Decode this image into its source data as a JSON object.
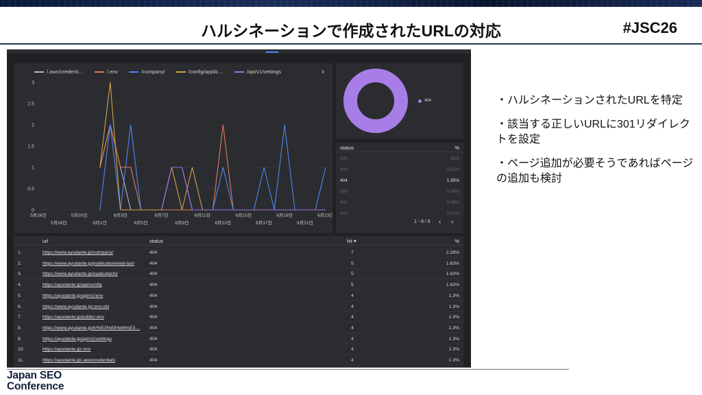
{
  "slide": {
    "title": "ハルシネーションで作成されたURLの対応",
    "hashtag": "#JSC26",
    "bullets": [
      "・ハルシネーションされたURLを特定",
      "・該当する正しいURLに301リダイレクトを設定",
      "・ページ追加が必要そうであればページの追加も検討"
    ],
    "logo_line1": "Japan SEO",
    "logo_line2": "Conference"
  },
  "line_chart": {
    "legend": [
      {
        "label": "/.aws/credenti…",
        "color": "#b8b8b8"
      },
      {
        "label": "/.env",
        "color": "#e07a5f"
      },
      {
        "label": "/company/",
        "color": "#4f86f7"
      },
      {
        "label": "/config/applic…",
        "color": "#d4a24c"
      },
      {
        "label": "/api/v1/settings",
        "color": "#a070e0"
      }
    ],
    "arrow": "›"
  },
  "chart_data": {
    "type": "line",
    "x_upper": [
      "5月26日",
      "5月30日",
      "6月3日",
      "6月7日",
      "6月11日",
      "6月15日",
      "6月19日",
      "6月23日"
    ],
    "x_lower": [
      "5月28日",
      "6月1日",
      "6月5日",
      "6月9日",
      "6月13日",
      "6月17日",
      "6月21日"
    ],
    "y_ticks": [
      "0",
      "0.5",
      "1",
      "1.5",
      "2",
      "2.5",
      "3"
    ],
    "ylim": [
      0,
      3
    ],
    "x_range": [
      0,
      28
    ],
    "series": [
      {
        "name": "/.aws/credenti…",
        "color": "#b8b8b8",
        "points": [
          [
            6,
            1
          ],
          [
            7,
            2
          ],
          [
            8,
            1
          ],
          [
            9,
            0
          ]
        ]
      },
      {
        "name": "/.env",
        "color": "#e07a5f",
        "points": [
          [
            6,
            1
          ],
          [
            7,
            2
          ],
          [
            8,
            1
          ],
          [
            9,
            1
          ],
          [
            10,
            0
          ],
          [
            17,
            0
          ],
          [
            18,
            2
          ],
          [
            19,
            0
          ],
          [
            28,
            0
          ]
        ]
      },
      {
        "name": "/company/",
        "color": "#4f86f7",
        "points": [
          [
            6,
            0
          ],
          [
            7,
            2
          ],
          [
            8,
            0
          ],
          [
            9,
            2
          ],
          [
            10,
            0
          ],
          [
            12,
            0
          ],
          [
            13,
            1
          ],
          [
            14,
            1
          ],
          [
            15,
            0
          ],
          [
            17,
            0
          ],
          [
            18,
            1
          ],
          [
            19,
            0
          ],
          [
            21,
            0
          ],
          [
            22,
            1
          ],
          [
            23,
            0
          ],
          [
            24,
            2
          ],
          [
            25,
            0
          ],
          [
            27,
            0
          ],
          [
            28,
            1
          ]
        ]
      },
      {
        "name": "/config/applic…",
        "color": "#d4a24c",
        "points": [
          [
            6,
            1
          ],
          [
            7,
            3
          ],
          [
            8,
            0
          ],
          [
            12,
            0
          ],
          [
            13,
            1
          ],
          [
            14,
            0
          ],
          [
            15,
            1
          ],
          [
            16,
            0
          ],
          [
            28,
            0
          ]
        ]
      },
      {
        "name": "/api/v1/settings",
        "color": "#a070e0",
        "points": [
          [
            12,
            0
          ],
          [
            13,
            1
          ],
          [
            14,
            1
          ],
          [
            15,
            0
          ],
          [
            28,
            0
          ]
        ]
      }
    ]
  },
  "donut": {
    "legend_label": "404",
    "color": "#a87de8",
    "percent": 100
  },
  "status_table": {
    "headers": {
      "status": "status",
      "pct": "%"
    },
    "rows": [
      {
        "status": "200",
        "pct": "95%",
        "hl": false
      },
      {
        "status": "301",
        "pct": "3.52%",
        "hl": false
      },
      {
        "status": "404",
        "pct": "1.35%",
        "hl": true
      },
      {
        "status": "500",
        "pct": "0.06%",
        "hl": false
      },
      {
        "status": "401",
        "pct": "0.05%",
        "hl": false
      },
      {
        "status": "403",
        "pct": "0.02%",
        "hl": false
      }
    ],
    "pager": "1 - 6 / 6",
    "prev": "‹",
    "next": "›"
  },
  "url_table": {
    "headers": {
      "url": "url",
      "status": "status",
      "hit": "hit ▾",
      "pct": "%"
    },
    "rows": [
      {
        "n": "1.",
        "url": "https://www.ayudante.jp/company/",
        "status": "404",
        "hit": "7",
        "pct": "2.28%"
      },
      {
        "n": "2.",
        "url": "https://www.ayudante.jp/publication/web-tan/",
        "status": "404",
        "hit": "5",
        "pct": "1.63%"
      },
      {
        "n": "3.",
        "url": "https://www.ayudante.jp/oyakudachi/",
        "status": "404",
        "hit": "5",
        "pct": "1.63%"
      },
      {
        "n": "4.",
        "url": "https://ayudante.jp/api/config",
        "status": "404",
        "hit": "5",
        "pct": "1.63%"
      },
      {
        "n": "5.",
        "url": "https://ayudante.jp/api/v1/env",
        "status": "404",
        "hit": "4",
        "pct": "1.3%"
      },
      {
        "n": "6.",
        "url": "https://www.ayudante.jp/.env.old",
        "status": "404",
        "hit": "4",
        "pct": "1.3%"
      },
      {
        "n": "7.",
        "url": "https://ayudante.jp/public/.env",
        "status": "404",
        "hit": "4",
        "pct": "1.3%"
      },
      {
        "n": "8.",
        "url": "https://www.ayudante.jp/ir/%E3%83%84%E3…",
        "status": "404",
        "hit": "4",
        "pct": "1.3%"
      },
      {
        "n": "9.",
        "url": "https://ayudante.jp/api/v1/settings",
        "status": "404",
        "hit": "4",
        "pct": "1.3%"
      },
      {
        "n": "10.",
        "url": "https://ayudante.jp/.env",
        "status": "404",
        "hit": "4",
        "pct": "1.3%"
      },
      {
        "n": "11.",
        "url": "https://ayudante.jp/.aws/credentials",
        "status": "404",
        "hit": "4",
        "pct": "1.3%"
      }
    ]
  }
}
